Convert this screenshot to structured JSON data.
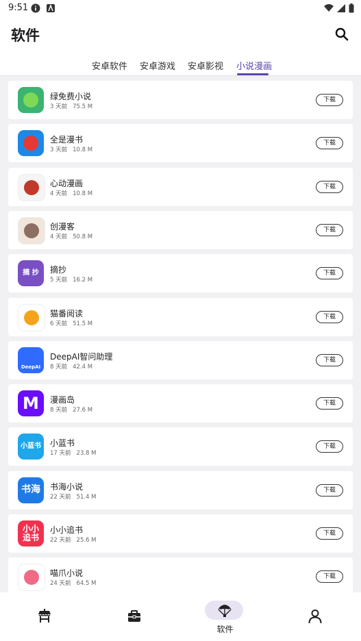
{
  "status": {
    "time": "9:51"
  },
  "header": {
    "title": "软件"
  },
  "tabs": [
    {
      "label": "安卓软件"
    },
    {
      "label": "安卓游戏"
    },
    {
      "label": "安卓影视"
    },
    {
      "label": "小说漫画"
    }
  ],
  "active_tab": "小说漫画",
  "download_label": "下载",
  "apps": [
    {
      "name": "绿免费小说",
      "age": "3 天前",
      "size": "75.5 M",
      "icon": "green-book-mascot-icon",
      "color": "#3cb371"
    },
    {
      "name": "全是漫书",
      "age": "3 天前",
      "size": "10.8 M",
      "icon": "reading-person-icon",
      "color": "#1e88e5"
    },
    {
      "name": "心动漫画",
      "age": "4 天前",
      "size": "10.8 M",
      "icon": "manga-character-icon",
      "color": "#f5f5f5"
    },
    {
      "name": "创漫客",
      "age": "4 天前",
      "size": "50.8 M",
      "icon": "raccoon-mascot-icon",
      "color": "#f0e6dc"
    },
    {
      "name": "摘抄",
      "age": "5 天前",
      "size": "16.2 M",
      "icon": "zhaichao-text-icon",
      "glyph": "摘 抄",
      "color": "#7a4fc4"
    },
    {
      "name": "猫番阅读",
      "age": "6 天前",
      "size": "51.5 M",
      "icon": "cat-reader-icon",
      "color": "#ffffff"
    },
    {
      "name": "DeepAI智问助理",
      "age": "8 天前",
      "size": "42.4 M",
      "icon": "robot-head-icon",
      "glyph": "DeepAI",
      "color": "#2f6bff"
    },
    {
      "name": "漫画岛",
      "age": "8 天前",
      "size": "27.6 M",
      "icon": "letter-m-icon",
      "glyph": "M",
      "color": "#6a0dfc"
    },
    {
      "name": "小蓝书",
      "age": "17 天前",
      "size": "23.8 M",
      "icon": "xiaolanshu-text-icon",
      "glyph": "小蓝书",
      "color": "#1ea7ea"
    },
    {
      "name": "书海小说",
      "age": "22 天前",
      "size": "51.4 M",
      "icon": "shuhai-text-icon",
      "glyph": "书海",
      "color": "#1e7be6"
    },
    {
      "name": "小小追书",
      "age": "22 天前",
      "size": "25.6 M",
      "icon": "xiaoxiao-text-icon",
      "glyph": "小小追书",
      "color": "#f0324f"
    },
    {
      "name": "喵爪小说",
      "age": "24 天前",
      "size": "64.5 M",
      "icon": "cat-paw-icon",
      "color": "#ffffff"
    }
  ],
  "bottom_nav": [
    {
      "icon": "stall-icon",
      "label": ""
    },
    {
      "icon": "toolbox-icon",
      "label": ""
    },
    {
      "icon": "parachute-icon",
      "label": "软件"
    },
    {
      "icon": "person-icon",
      "label": ""
    }
  ]
}
